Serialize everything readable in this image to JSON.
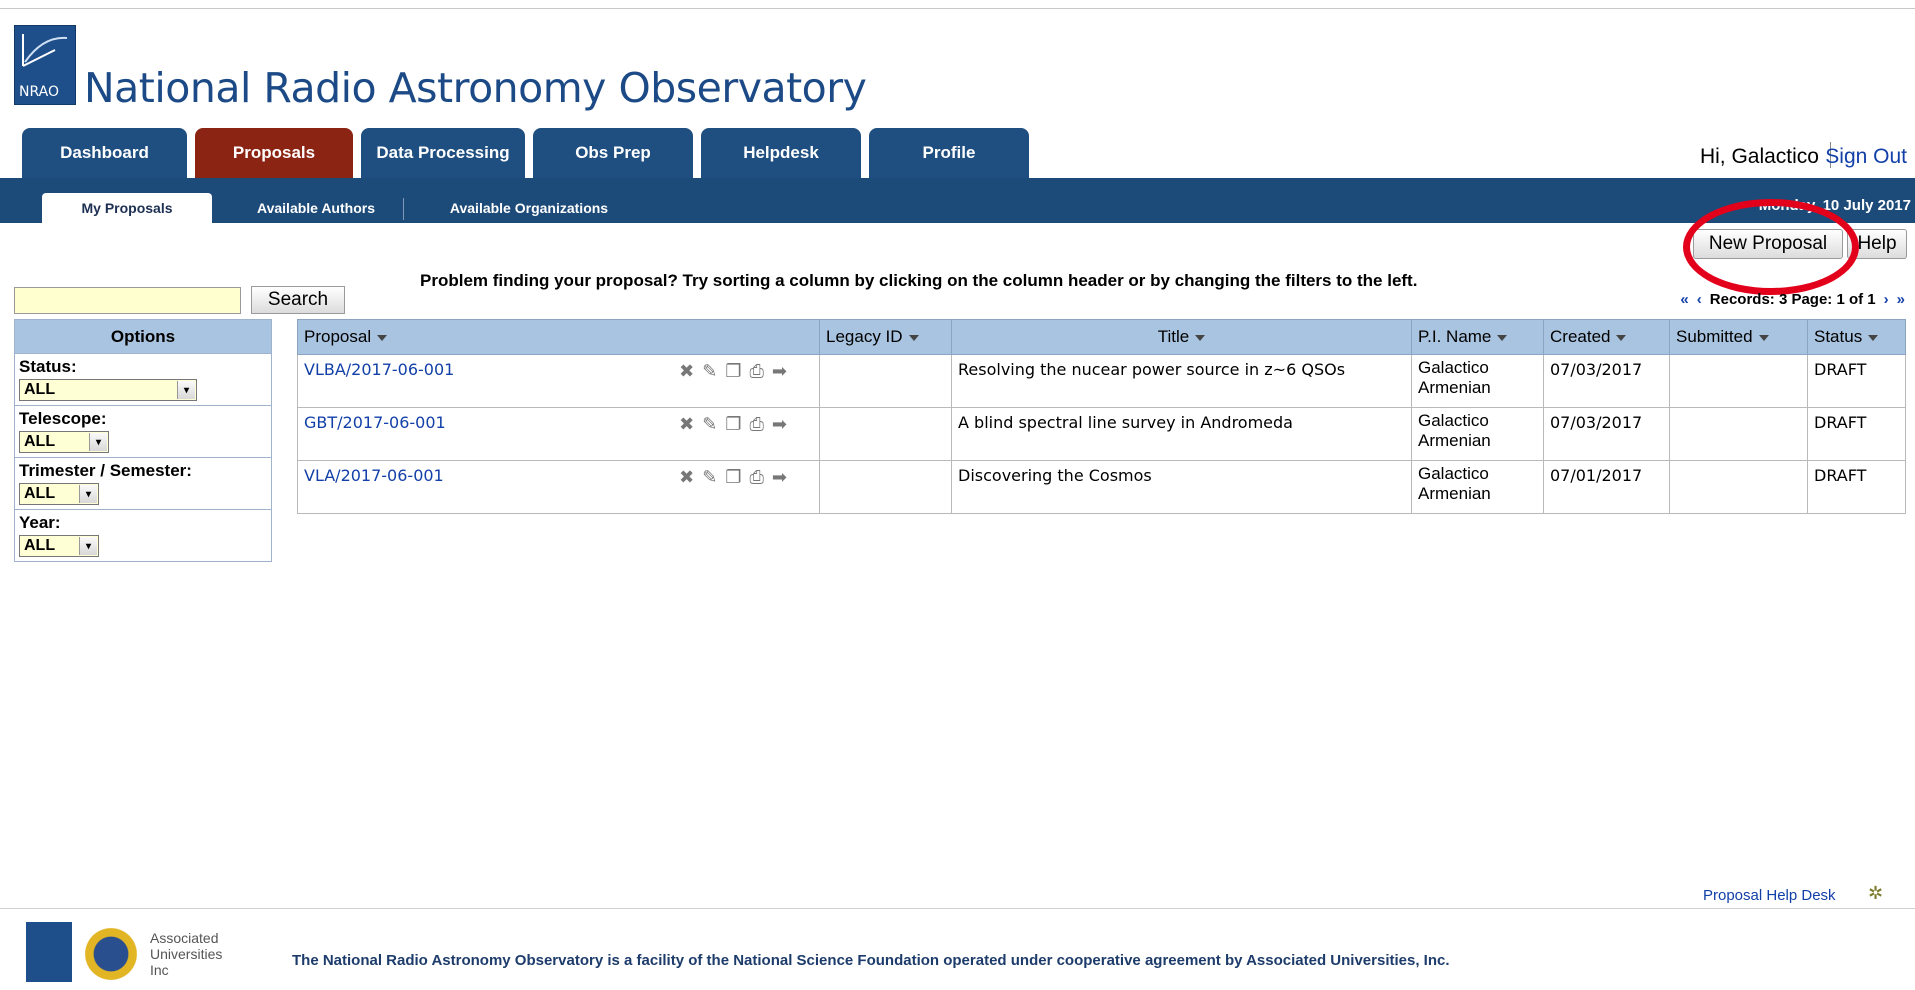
{
  "header": {
    "site_title": "National Radio Astronomy Observatory",
    "logo_label": "NRAO",
    "tabs": [
      {
        "label": "Dashboard",
        "active": false
      },
      {
        "label": "Proposals",
        "active": true
      },
      {
        "label": "Data Processing",
        "active": false
      },
      {
        "label": "Obs Prep",
        "active": false
      },
      {
        "label": "Helpdesk",
        "active": false
      },
      {
        "label": "Profile",
        "active": false
      }
    ],
    "greeting": "Hi, Galactico",
    "sign_out": "Sign Out"
  },
  "subnav": {
    "tabs": [
      "My Proposals",
      "Available Authors",
      "Available Organizations"
    ],
    "date": "Monday, 10 July 2017"
  },
  "actions": {
    "new_proposal": "New Proposal",
    "help": "Help"
  },
  "search": {
    "value": "",
    "button": "Search"
  },
  "notice": "Problem finding your proposal? Try sorting a column by clicking on the column header or by changing the filters to the left.",
  "pager": {
    "first": "«",
    "prev": "‹",
    "records_text": "Records: 3 Page: 1 of 1",
    "next": "›",
    "last": "»"
  },
  "options": {
    "title": "Options",
    "filters": [
      {
        "label": "Status:",
        "value": "ALL"
      },
      {
        "label": "Telescope:",
        "value": "ALL"
      },
      {
        "label": "Trimester / Semester:",
        "value": "ALL"
      },
      {
        "label": "Year:",
        "value": "ALL"
      }
    ]
  },
  "table": {
    "columns": [
      "Proposal",
      "Legacy ID",
      "Title",
      "P.I. Name",
      "Created",
      "Submitted",
      "Status"
    ],
    "rows": [
      {
        "proposal": "VLBA/2017-06-001",
        "legacy_id": "",
        "title": "Resolving the nucear power source in z~6 QSOs",
        "pi_name": "Galactico Armenian",
        "created": "07/03/2017",
        "submitted": "",
        "status": "DRAFT"
      },
      {
        "proposal": "GBT/2017-06-001",
        "legacy_id": "",
        "title": "A blind spectral line survey in Andromeda",
        "pi_name": "Galactico Armenian",
        "created": "07/03/2017",
        "submitted": "",
        "status": "DRAFT"
      },
      {
        "proposal": "VLA/2017-06-001",
        "legacy_id": "",
        "title": "Discovering the Cosmos",
        "pi_name": "Galactico Armenian",
        "created": "07/01/2017",
        "submitted": "",
        "status": "DRAFT"
      }
    ],
    "row_action_icons": [
      "delete-icon",
      "edit-icon",
      "copy-icon",
      "print-icon",
      "submit-arrow-icon"
    ]
  },
  "footer": {
    "helpdesk_link": "Proposal Help Desk",
    "aui_label": "Associated Universities Inc",
    "text": "The National Radio Astronomy Observatory is a facility of the National Science Foundation operated under cooperative agreement by Associated Universities, Inc."
  },
  "colors": {
    "tab_bg": "#1f4f80",
    "tab_active_bg": "#8b2412",
    "subnav_bg": "#1d4b79",
    "table_header_bg": "#a9c4e0",
    "link": "#1240a8",
    "highlight": "#e3001b"
  }
}
